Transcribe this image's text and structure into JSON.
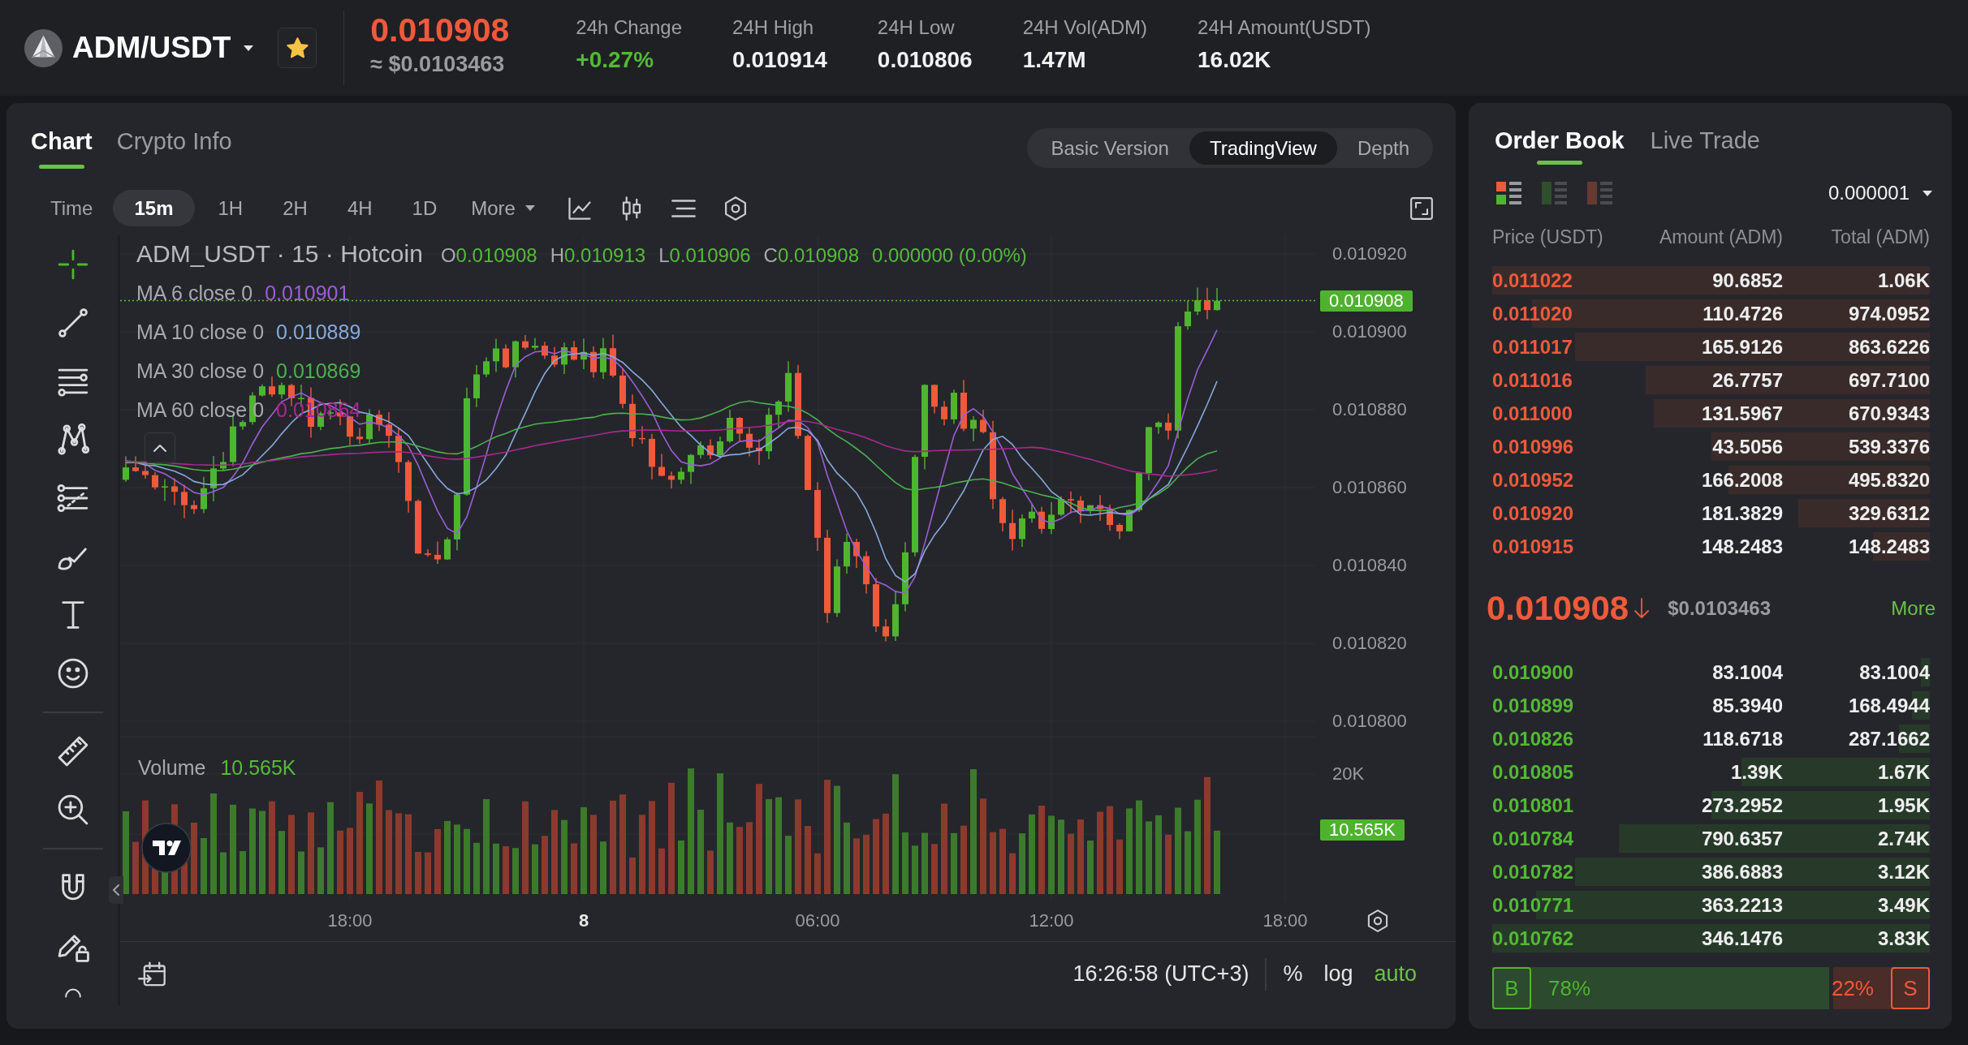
{
  "header": {
    "pair": "ADM/USDT",
    "favorite": true,
    "price": "0.010908",
    "falling": true,
    "price_usd": "≈ $0.0103463",
    "stats": [
      {
        "label": "24h Change",
        "value": "+0.27%",
        "positive": true
      },
      {
        "label": "24H High",
        "value": "0.010914",
        "positive": false
      },
      {
        "label": "24H Low",
        "value": "0.010806",
        "positive": false
      },
      {
        "label": "24H Vol(ADM)",
        "value": "1.47M",
        "positive": false
      },
      {
        "label": "24H Amount(USDT)",
        "value": "16.02K",
        "positive": false
      }
    ]
  },
  "chart": {
    "tabs": [
      {
        "label": "Chart",
        "selected": true
      },
      {
        "label": "Crypto Info",
        "selected": false
      }
    ],
    "views": [
      {
        "label": "Basic Version",
        "selected": false
      },
      {
        "label": "TradingView",
        "selected": true
      },
      {
        "label": "Depth",
        "selected": false
      }
    ],
    "toolbar": {
      "time_label": "Time",
      "intervals": [
        {
          "label": "15m",
          "selected": true
        },
        {
          "label": "1H",
          "selected": false
        },
        {
          "label": "2H",
          "selected": false
        },
        {
          "label": "4H",
          "selected": false
        },
        {
          "label": "1D",
          "selected": false
        }
      ],
      "more": "More"
    },
    "drawing_tools": [
      {
        "tools": [
          {
            "kind": "crosshair",
            "selected": true
          },
          {
            "kind": "trend-line",
            "selected": false
          },
          {
            "kind": "horizontal-lines",
            "selected": false
          },
          {
            "kind": "pattern",
            "selected": false
          },
          {
            "kind": "levels",
            "selected": false
          },
          {
            "kind": "brush",
            "selected": false
          },
          {
            "kind": "text",
            "selected": false
          },
          {
            "kind": "emoji",
            "selected": false
          }
        ]
      },
      {
        "tools": [
          {
            "kind": "ruler",
            "selected": false
          },
          {
            "kind": "zoom-in",
            "selected": false
          }
        ]
      },
      {
        "tools": [
          {
            "kind": "magnet",
            "selected": false
          },
          {
            "kind": "lock",
            "selected": false
          },
          {
            "kind": "arc",
            "selected": false
          }
        ]
      }
    ],
    "legend": {
      "symbol": "ADM_USDT · 15 · Hotcoin",
      "ohlc": [
        {
          "key": "O",
          "value": "0.010908"
        },
        {
          "key": "H",
          "value": "0.010913"
        },
        {
          "key": "L",
          "value": "0.010906"
        },
        {
          "key": "C",
          "value": "0.010908"
        }
      ],
      "change": "0.000000 (0.00%)"
    },
    "moving_averages": [
      {
        "label": "MA 6 close 0",
        "value": "0.010901",
        "color": "#9b5fd6"
      },
      {
        "label": "MA 10 close 0",
        "value": "0.010889",
        "color": "#86a9dc"
      },
      {
        "label": "MA 30 close 0",
        "value": "0.010869",
        "color": "#4caf50"
      },
      {
        "label": "MA 60 close 0",
        "value": "0.010864",
        "color": "#a8288f"
      }
    ],
    "price_axis": [
      "0.010920",
      "0.010900",
      "0.010880",
      "0.010860",
      "0.010840",
      "0.010820",
      "0.010800"
    ],
    "last_price_tag": "0.010908",
    "volume": {
      "label": "Volume",
      "value": "10.565K",
      "axis": "20K",
      "tag": "10.565K"
    },
    "time_axis": [
      {
        "label": "18:00",
        "kind": "time"
      },
      {
        "label": "8",
        "kind": "date"
      },
      {
        "label": "06:00",
        "kind": "time"
      },
      {
        "label": "12:00",
        "kind": "time"
      },
      {
        "label": "18:00",
        "kind": "time"
      }
    ],
    "status_bar": {
      "clock": "16:26:58 (UTC+3)",
      "scales": [
        {
          "label": "%",
          "selected": false
        },
        {
          "label": "log",
          "selected": false
        },
        {
          "label": "auto",
          "selected": true
        }
      ]
    }
  },
  "order_book": {
    "tabs": [
      {
        "label": "Order Book",
        "selected": true
      },
      {
        "label": "Live Trade",
        "selected": false
      }
    ],
    "layouts": [
      {
        "kind": "both",
        "selected": true
      },
      {
        "kind": "bids",
        "selected": false
      },
      {
        "kind": "asks",
        "selected": false
      }
    ],
    "precision": "0.000001",
    "columns": [
      "Price (USDT)",
      "Amount (ADM)",
      "Total (ADM)"
    ],
    "asks": [
      {
        "price": "0.011022",
        "amount": "90.6852",
        "total": "1.06K",
        "level": 1.0
      },
      {
        "price": "0.011020",
        "amount": "110.4726",
        "total": "974.0952",
        "level": 0.91
      },
      {
        "price": "0.011017",
        "amount": "165.9126",
        "total": "863.6226",
        "level": 0.81
      },
      {
        "price": "0.011016",
        "amount": "26.7757",
        "total": "697.7100",
        "level": 0.65
      },
      {
        "price": "0.011000",
        "amount": "131.5967",
        "total": "670.9343",
        "level": 0.63
      },
      {
        "price": "0.010996",
        "amount": "43.5056",
        "total": "539.3376",
        "level": 0.5
      },
      {
        "price": "0.010952",
        "amount": "166.2008",
        "total": "495.8320",
        "level": 0.46
      },
      {
        "price": "0.010920",
        "amount": "181.3829",
        "total": "329.6312",
        "level": 0.3
      },
      {
        "price": "0.010915",
        "amount": "148.2483",
        "total": "148.2483",
        "level": 0.13
      }
    ],
    "mid": {
      "price": "0.010908",
      "falling": true,
      "usd": "$0.0103463",
      "more": "More"
    },
    "bids": [
      {
        "price": "0.010900",
        "amount": "83.1004",
        "total": "83.1004",
        "level": 0.02
      },
      {
        "price": "0.010899",
        "amount": "85.3940",
        "total": "168.4944",
        "level": 0.04
      },
      {
        "price": "0.010826",
        "amount": "118.6718",
        "total": "287.1662",
        "level": 0.07
      },
      {
        "price": "0.010805",
        "amount": "1.39K",
        "total": "1.67K",
        "level": 0.43
      },
      {
        "price": "0.010801",
        "amount": "273.2952",
        "total": "1.95K",
        "level": 0.5
      },
      {
        "price": "0.010784",
        "amount": "790.6357",
        "total": "2.74K",
        "level": 0.71
      },
      {
        "price": "0.010782",
        "amount": "386.6883",
        "total": "3.12K",
        "level": 0.81
      },
      {
        "price": "0.010771",
        "amount": "363.2213",
        "total": "3.49K",
        "level": 0.9
      },
      {
        "price": "0.010762",
        "amount": "346.1476",
        "total": "3.83K",
        "level": 1.0
      }
    ],
    "ratio": {
      "buy_label": "B",
      "buy_percent": "78%",
      "sell_percent": "22%",
      "sell_label": "S",
      "level": 0.78
    }
  }
}
